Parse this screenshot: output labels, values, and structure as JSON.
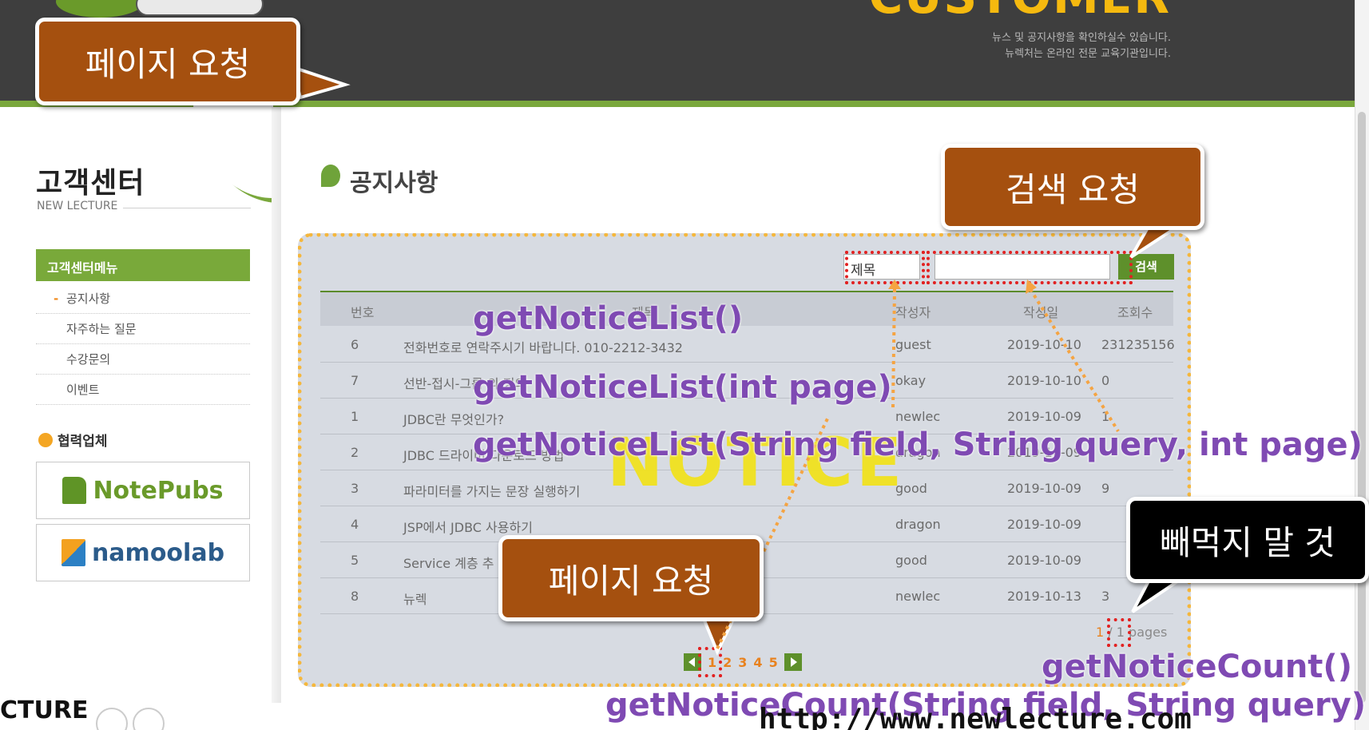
{
  "header": {
    "brand_word": "CUSTOMER",
    "desc_line1": "뉴스 및 공지사항을 확인하실수 있습니다.",
    "desc_line2": "뉴렉처는 온라인 전문 교육기관입니다."
  },
  "sidebar": {
    "title": "고객센터",
    "subtitle": "NEW LECTURE",
    "menu_head": "고객센터메뉴",
    "items": [
      {
        "label": "공지사항",
        "active": true
      },
      {
        "label": "자주하는 질문",
        "active": false
      },
      {
        "label": "수강문의",
        "active": false
      },
      {
        "label": "이벤트",
        "active": false
      }
    ],
    "partner_title": "협력업체",
    "partners": [
      "NotePubs",
      "namoolab"
    ]
  },
  "main": {
    "title": "공지사항",
    "search": {
      "field_value": "제목",
      "query_value": "",
      "button_label": "검색"
    },
    "columns": [
      "번호",
      "제목",
      "작성자",
      "작성일",
      "조회수"
    ],
    "rows": [
      {
        "no": "6",
        "title": "전화번호로 연락주시기 바랍니다. 010-2212-3432",
        "writer": "guest",
        "date": "2019-10-10",
        "hit": "231235156"
      },
      {
        "no": "7",
        "title": "선반-접시-그룹 의 정의",
        "writer": "okay",
        "date": "2019-10-10",
        "hit": "0"
      },
      {
        "no": "1",
        "title": "JDBC란 무엇인가?",
        "writer": "newlec",
        "date": "2019-10-09",
        "hit": "1"
      },
      {
        "no": "2",
        "title": "JDBC 드라이버 다운로드 방법",
        "writer": "dragon",
        "date": "2019-10-09",
        "hit": ""
      },
      {
        "no": "3",
        "title": "파라미터를 가지는 문장 실행하기",
        "writer": "good",
        "date": "2019-10-09",
        "hit": "9"
      },
      {
        "no": "4",
        "title": "JSP에서 JDBC 사용하기",
        "writer": "dragon",
        "date": "2019-10-09",
        "hit": ""
      },
      {
        "no": "5",
        "title": "Service 계층 추",
        "writer": "good",
        "date": "2019-10-09",
        "hit": ""
      },
      {
        "no": "8",
        "title": "뉴렉",
        "writer": "newlec",
        "date": "2019-10-13",
        "hit": "3"
      }
    ],
    "watermark": "NOTICE",
    "pages_current": "1",
    "pages_sep": "/ 1",
    "pages_label": "pages",
    "pager": [
      "1",
      "2",
      "3",
      "4",
      "5"
    ]
  },
  "annotations": {
    "callout_page_top": "페이지 요청",
    "callout_search": "검색 요청",
    "callout_page_bottom": "페이지 요청",
    "callout_dont_miss": "빼먹지 말 것",
    "code1": "getNoticeList()",
    "code2": "getNoticeList(int page)",
    "code3": "getNoticeList(String field, String query, int page)",
    "code4": "getNoticeCount()",
    "code5": "getNoticeCount(String field, String query)"
  },
  "footer": {
    "brand_fragment": "CTURE",
    "url": "http://www.newlecture.com"
  },
  "colors": {
    "accent_green": "#79a93a",
    "callout_brown": "#a5500f",
    "code_purple": "#7f4ab3",
    "dotted_orange": "#f5b73c",
    "dotted_red": "#e22121",
    "watermark_yellow": "#f1e21f"
  }
}
